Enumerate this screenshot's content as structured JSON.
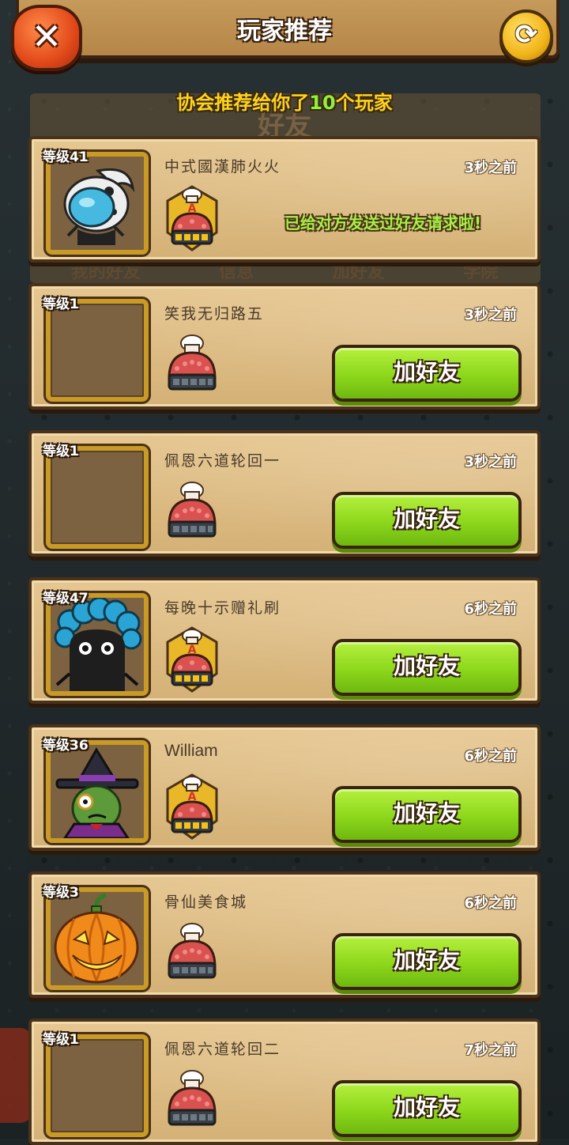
{
  "header": {
    "title": "玩家推荐",
    "close_icon": "✕",
    "refresh_icon": "⟳"
  },
  "subtitle": {
    "prefix": "协会推荐给你了",
    "count": "10",
    "suffix": "个玩家"
  },
  "background": {
    "title": "好友",
    "tabs": [
      "我的好友",
      "信息",
      "加好友",
      "学院"
    ]
  },
  "colors": {
    "accent_green": "#8cd71c",
    "gold": "#ffd21e",
    "wood": "#d4b176"
  },
  "players": [
    {
      "level": "等级41",
      "name": "中式國漢肺火火",
      "time": "3秒之前",
      "badge": "A",
      "avatar": "blue-blob-with-skull-hat",
      "status": "已给对方发送过好友请求啦!"
    },
    {
      "level": "等级1",
      "name": "笑我无归路五",
      "time": "3秒之前",
      "badge": "",
      "avatar": "empty",
      "button": "加好友"
    },
    {
      "level": "等级1",
      "name": "佩恩六道轮回一",
      "time": "3秒之前",
      "badge": "",
      "avatar": "empty",
      "button": "加好友"
    },
    {
      "level": "等级47",
      "name": "每晚十示赠礼刷",
      "time": "6秒之前",
      "badge": "A",
      "avatar": "black-blob-blue-afro",
      "button": "加好友"
    },
    {
      "level": "等级36",
      "name": "William",
      "time": "6秒之前",
      "badge": "A",
      "avatar": "green-witch-hat",
      "button": "加好友"
    },
    {
      "level": "等级3",
      "name": "骨仙美食城",
      "time": "6秒之前",
      "badge": "",
      "avatar": "pumpkin",
      "button": "加好友"
    },
    {
      "level": "等级1",
      "name": "佩恩六道轮回二",
      "time": "7秒之前",
      "badge": "",
      "avatar": "empty",
      "button": "加好友"
    }
  ]
}
